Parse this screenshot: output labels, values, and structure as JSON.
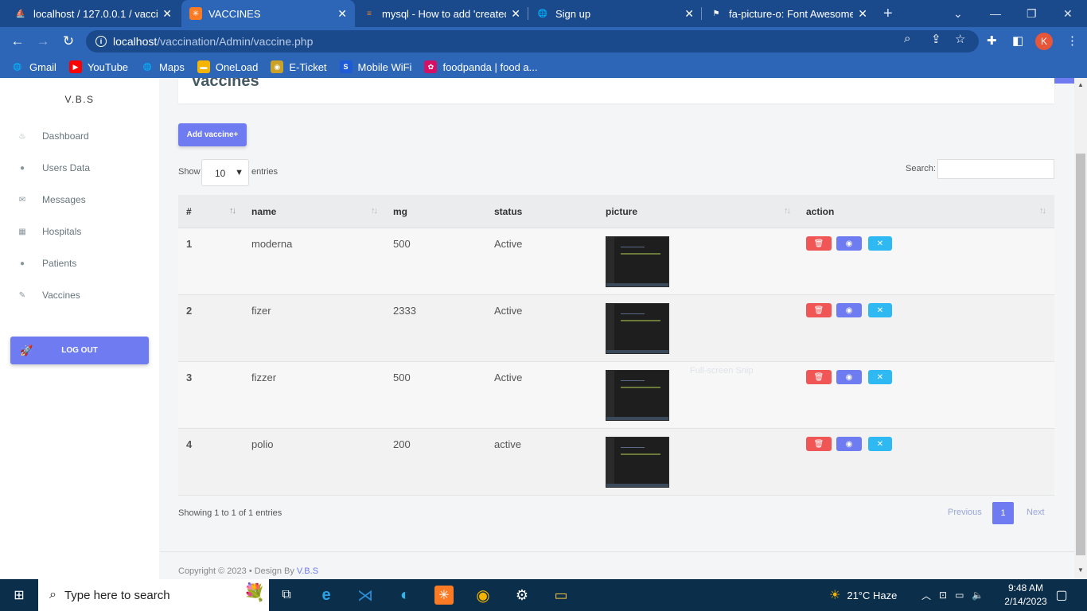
{
  "tabs": [
    {
      "title": "localhost / 127.0.0.1 / vaccina",
      "icon": "phpmyadmin-icon",
      "color": "#f39c12"
    },
    {
      "title": "VACCINES",
      "icon": "xampp-icon",
      "color": "#fb7a24"
    },
    {
      "title": "mysql - How to add 'created_",
      "icon": "stackoverflow-icon",
      "color": "#f48024"
    },
    {
      "title": "Sign up",
      "icon": "globe-icon",
      "color": "#ffffff"
    },
    {
      "title": "fa-picture-o: Font Awesome",
      "icon": "flag-icon",
      "color": "#ffffff"
    }
  ],
  "address": {
    "host": "localhost",
    "path": "/vaccination/Admin/vaccine.php"
  },
  "profile_initial": "K",
  "bookmarks": [
    {
      "label": "Gmail",
      "icon": "globe-icon",
      "color": "#ffffff"
    },
    {
      "label": "YouTube",
      "icon": "youtube-icon",
      "color": "#ff0000"
    },
    {
      "label": "Maps",
      "icon": "globe-icon",
      "color": "#ffffff"
    },
    {
      "label": "OneLoad",
      "icon": "oneload-icon",
      "color": "#f4b400"
    },
    {
      "label": "E-Ticket",
      "icon": "eticket-icon",
      "color": "#c9a227"
    },
    {
      "label": "Mobile WiFi",
      "icon": "wifi-s-icon",
      "color": "#1e5bd6"
    },
    {
      "label": "foodpanda | food a...",
      "icon": "foodpanda-icon",
      "color": "#d70f64"
    }
  ],
  "sidebar": {
    "brand": "V.B.S",
    "items": [
      {
        "label": "Dashboard",
        "icon": "fire-icon"
      },
      {
        "label": "Users Data",
        "icon": "user-icon"
      },
      {
        "label": "Messages",
        "icon": "envelope-icon"
      },
      {
        "label": "Hospitals",
        "icon": "building-icon"
      },
      {
        "label": "Patients",
        "icon": "user-icon"
      },
      {
        "label": "Vaccines",
        "icon": "syringe-icon"
      }
    ],
    "logout": "LOG OUT"
  },
  "main": {
    "title": "Vaccines",
    "add_button": "Add vaccine+",
    "show_label": "Show",
    "entries_select": "10",
    "entries_label": "entries",
    "search_label": "Search:",
    "columns": [
      "#",
      "name",
      "mg",
      "status",
      "picture",
      "action"
    ],
    "rows": [
      {
        "id": "1",
        "name": "moderna",
        "mg": "500",
        "status": "Active"
      },
      {
        "id": "2",
        "name": "fizer",
        "mg": "2333",
        "status": "Active"
      },
      {
        "id": "3",
        "name": "fizzer",
        "mg": "500",
        "status": "Active"
      },
      {
        "id": "4",
        "name": "polio",
        "mg": "200",
        "status": "active"
      }
    ],
    "showing": "Showing 1 to 1 of 1 entries",
    "pagination": {
      "previous": "Previous",
      "current": "1",
      "next": "Next"
    },
    "ghost_text": "Full-screen Snip"
  },
  "footer": {
    "copyright": "Copyright © 2023 •  Design By ",
    "brand": "V.B.S"
  },
  "taskbar": {
    "search_placeholder": "Type here to search",
    "weather": "21°C  Haze",
    "time": "9:48 AM",
    "date": "2/14/2023"
  },
  "colors": {
    "accent": "#6f7bf0",
    "danger": "#f05656",
    "info": "#2fb9f2",
    "chrome": "#2d66b7"
  }
}
